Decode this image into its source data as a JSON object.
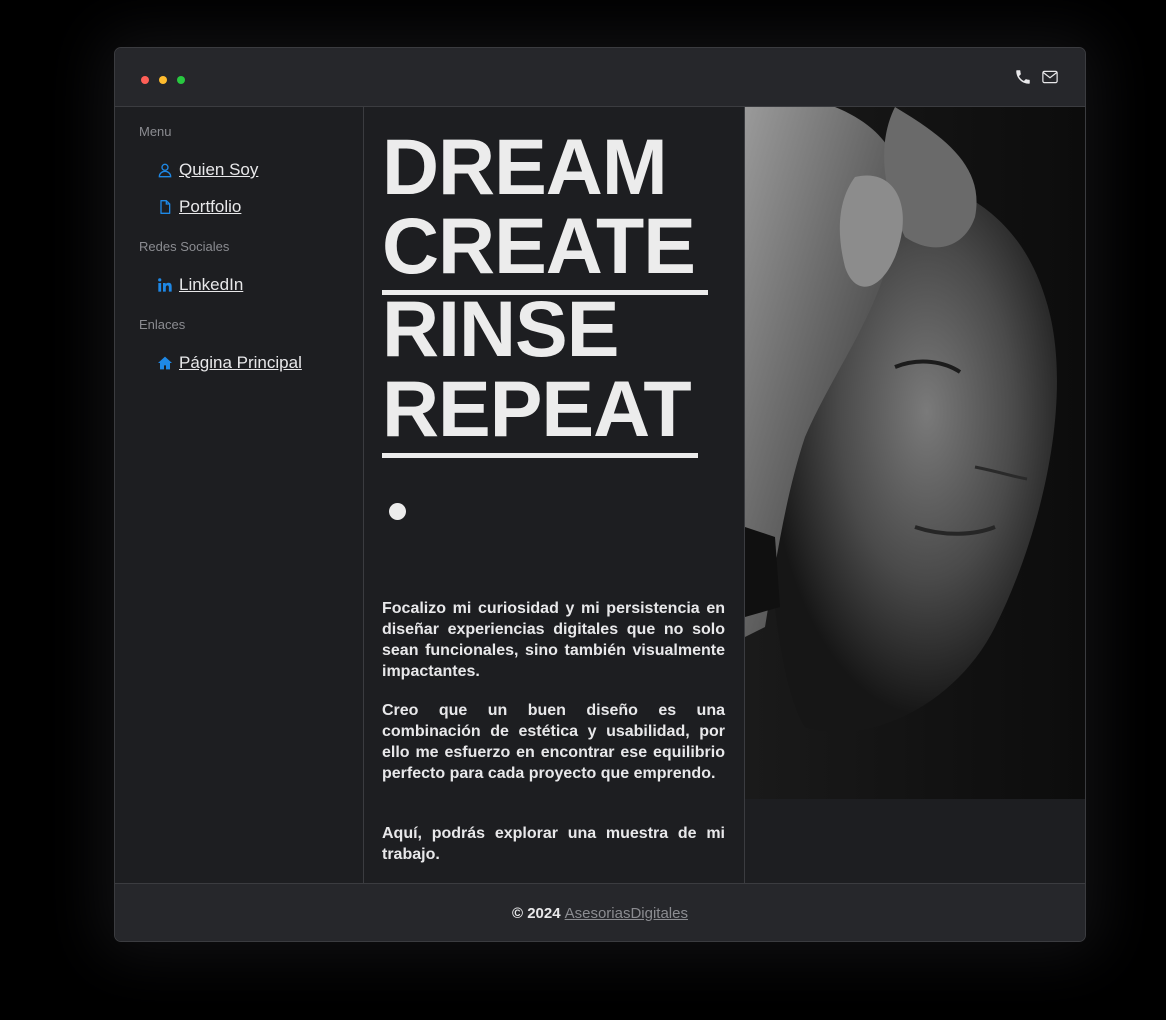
{
  "titlebar": {
    "window_controls": [
      "close",
      "minimize",
      "maximize"
    ],
    "icons": [
      "phone-icon",
      "mail-icon"
    ]
  },
  "sidebar": {
    "sections": [
      {
        "label": "Menu",
        "items": [
          {
            "label": "Quien Soy",
            "icon": "user-icon"
          },
          {
            "label": "Portfolio",
            "icon": "file-icon"
          }
        ]
      },
      {
        "label": "Redes Sociales",
        "items": [
          {
            "label": "LinkedIn",
            "icon": "linkedin-icon"
          }
        ]
      },
      {
        "label": "Enlaces",
        "items": [
          {
            "label": "Página Principal",
            "icon": "home-icon"
          }
        ]
      }
    ]
  },
  "hero": {
    "words": [
      "DREAM",
      "CREATE",
      "RINSE",
      "REPEAT"
    ]
  },
  "main": {
    "paragraphs": [
      "Focalizo mi curiosidad y mi persistencia en diseñar experiencias digitales que no solo sean funcionales, sino también visualmente impactantes.",
      "Creo que un buen diseño es una combinación de estética y usabilidad, por ello me esfuerzo en encontrar ese equilibrio perfecto para cada proyecto que emprendo.",
      "Aquí, podrás explorar una muestra de mi trabajo."
    ]
  },
  "footer": {
    "copyright": "© 2024",
    "link": "AsesoriasDigitales"
  },
  "colors": {
    "accent": "#1e88e5",
    "background": "#1d1e21",
    "bar": "#26272b",
    "text": "#ececec"
  }
}
